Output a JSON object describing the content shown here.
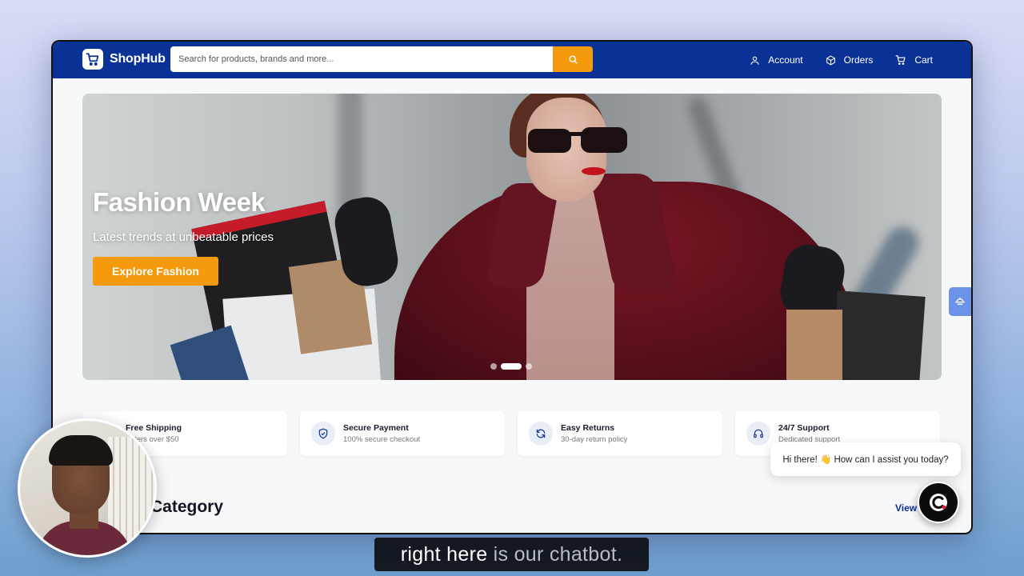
{
  "brand": {
    "name": "ShopHub",
    "accent": "#0a3196",
    "cta": "#f59a0c"
  },
  "search": {
    "placeholder": "Search for products, brands and more..."
  },
  "nav": [
    {
      "label": "Account",
      "icon": "user-icon"
    },
    {
      "label": "Orders",
      "icon": "box-icon"
    },
    {
      "label": "Cart",
      "icon": "cart-icon"
    }
  ],
  "hero": {
    "title": "Fashion Week",
    "subtitle": "Latest trends at unbeatable prices",
    "cta": "Explore Fashion",
    "slides_total": 3,
    "slide_active": 2
  },
  "features": [
    {
      "title": "Free Shipping",
      "subtitle": "orders over $50",
      "icon": "truck-icon"
    },
    {
      "title": "Secure Payment",
      "subtitle": "100% secure checkout",
      "icon": "shield-icon"
    },
    {
      "title": "Easy Returns",
      "subtitle": "30-day return policy",
      "icon": "refresh-icon"
    },
    {
      "title": "24/7 Support",
      "subtitle": "Dedicated support",
      "icon": "headset-icon"
    }
  ],
  "section": {
    "title": "Category",
    "view_all": "View"
  },
  "chat": {
    "greeting": "Hi there! 👋 How can I assist you today?",
    "icon": "chatbot-logo-icon"
  },
  "caption": {
    "highlight": "right here",
    "rest": " is our chatbot."
  }
}
